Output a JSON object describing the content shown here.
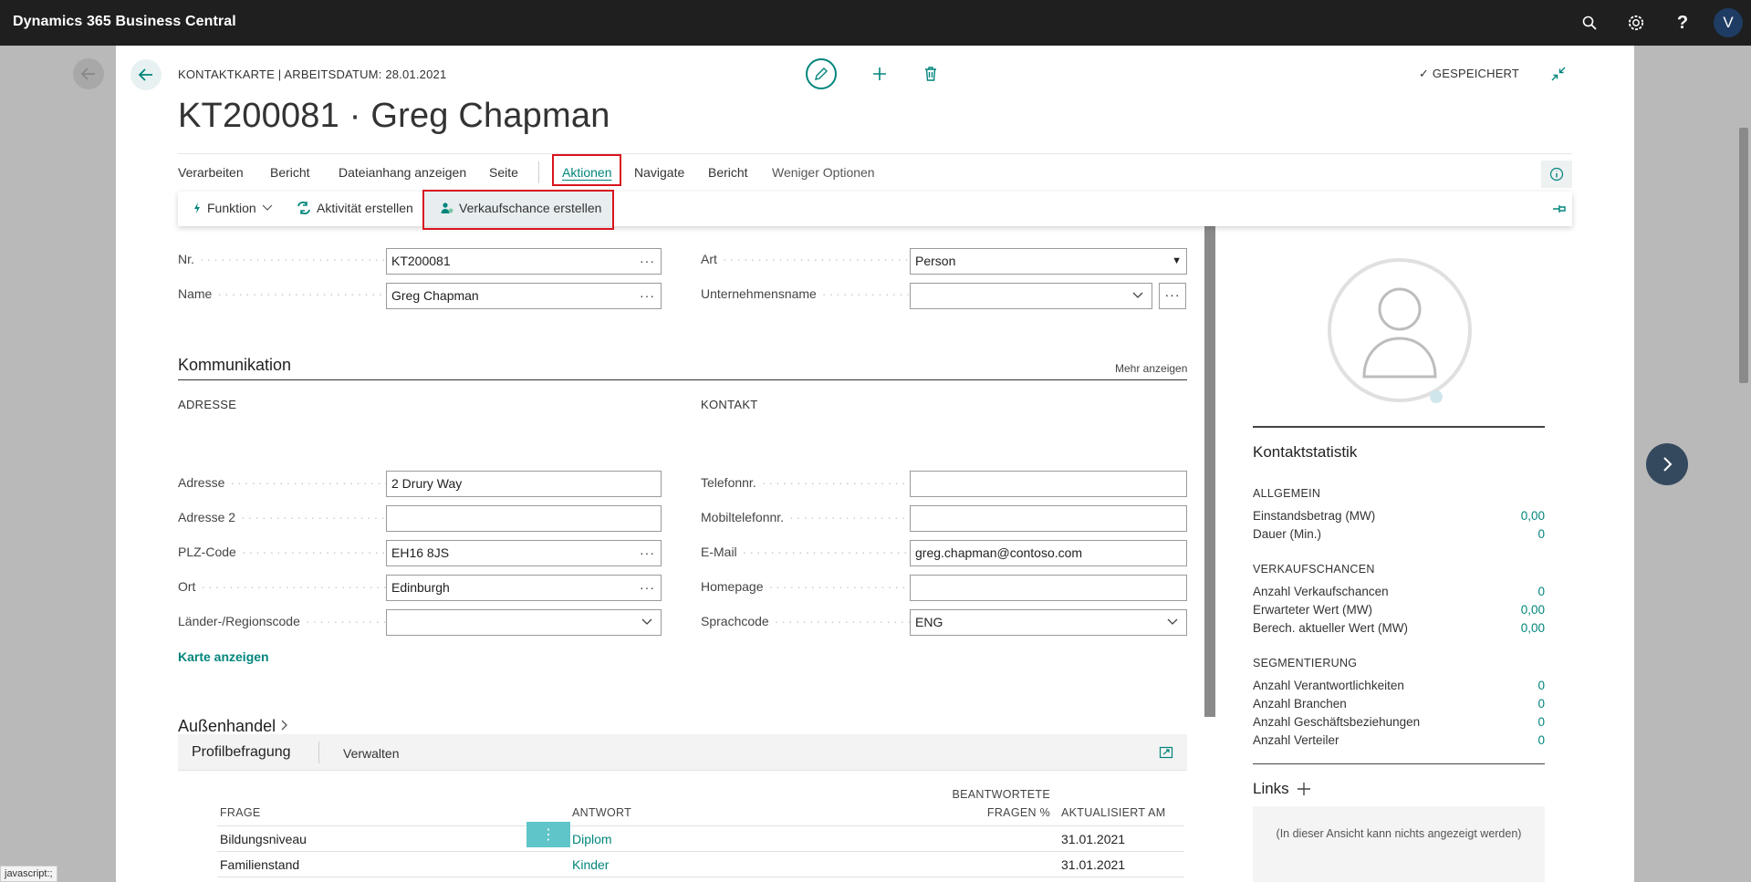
{
  "app": {
    "title": "Dynamics 365 Business Central",
    "user_initial": "V"
  },
  "header": {
    "breadcrumb": "KONTAKTKARTE | ARBEITSDATUM: 28.01.2021",
    "saved_label": "GESPEICHERT",
    "page_title": "KT200081 · Greg Chapman"
  },
  "actionbar": {
    "items": [
      "Verarbeiten",
      "Bericht",
      "Dateianhang anzeigen",
      "Seite",
      "Aktionen",
      "Navigate",
      "Bericht",
      "Weniger Optionen"
    ]
  },
  "submenu": {
    "items": [
      "Funktion",
      "Aktivität erstellen",
      "Verkaufschance erstellen"
    ]
  },
  "general": {
    "nr_label": "Nr.",
    "nr_value": "KT200081",
    "name_label": "Name",
    "name_value": "Greg Chapman",
    "art_label": "Art",
    "art_value": "Person",
    "company_label": "Unternehmensname",
    "company_value": ""
  },
  "communication": {
    "title": "Kommunikation",
    "more_link": "Mehr anzeigen",
    "address_head": "ADRESSE",
    "contact_head": "KONTAKT",
    "address_fields": [
      {
        "label": "Adresse",
        "value": "2 Drury Way"
      },
      {
        "label": "Adresse 2",
        "value": ""
      },
      {
        "label": "PLZ-Code",
        "value": "EH16 8JS"
      },
      {
        "label": "Ort",
        "value": "Edinburgh"
      },
      {
        "label": "Länder-/Regionscode",
        "value": ""
      }
    ],
    "contact_fields": [
      {
        "label": "Telefonnr.",
        "value": ""
      },
      {
        "label": "Mobiltelefonnr.",
        "value": ""
      },
      {
        "label": "E-Mail",
        "value": "greg.chapman@contoso.com"
      },
      {
        "label": "Homepage",
        "value": ""
      },
      {
        "label": "Sprachcode",
        "value": "ENG"
      }
    ],
    "map_link": "Karte anzeigen"
  },
  "foreign_trade": {
    "title": "Außenhandel"
  },
  "profile": {
    "title": "Profilbefragung",
    "manage": "Verwalten",
    "columns": {
      "frage": "FRAGE",
      "antwort": "ANTWORT",
      "beantwortete_1": "BEANTWORTETE",
      "beantwortete_2": "FRAGEN %",
      "aktualisiert": "AKTUALISIERT AM"
    },
    "rows": [
      {
        "frage": "Bildungsniveau",
        "antwort": "Diplom",
        "aktualisiert": "31.01.2021"
      },
      {
        "frage": "Familienstand",
        "antwort": "Kinder",
        "aktualisiert": "31.01.2021"
      }
    ]
  },
  "factbox": {
    "title": "Kontaktstatistik",
    "general_head": "ALLGEMEIN",
    "general": [
      {
        "label": "Einstandsbetrag (MW)",
        "value": "0,00"
      },
      {
        "label": "Dauer (Min.)",
        "value": "0"
      }
    ],
    "sales_head": "VERKAUFSCHANCEN",
    "sales": [
      {
        "label": "Anzahl Verkaufschancen",
        "value": "0"
      },
      {
        "label": "Erwarteter Wert (MW)",
        "value": "0,00"
      },
      {
        "label": "Berech. aktueller Wert (MW)",
        "value": "0,00"
      }
    ],
    "seg_head": "SEGMENTIERUNG",
    "seg": [
      {
        "label": "Anzahl Verantwortlichkeiten",
        "value": "0"
      },
      {
        "label": "Anzahl Branchen",
        "value": "0"
      },
      {
        "label": "Anzahl Geschäftsbeziehungen",
        "value": "0"
      },
      {
        "label": "Anzahl Verteiler",
        "value": "0"
      }
    ],
    "links_title": "Links",
    "links_empty": "(In dieser Ansicht kann nichts angezeigt werden)"
  },
  "status_bar": "javascript:;",
  "colors": {
    "accent": "#00857c",
    "highlight": "#d9141e",
    "appbar": "#1f1f1f"
  },
  "icons": [
    "search-icon",
    "settings-icon",
    "help-icon",
    "back-arrow-icon",
    "edit-icon",
    "add-icon",
    "delete-icon",
    "check-icon",
    "collapse-icon",
    "info-icon",
    "pin-icon",
    "lightning-icon",
    "activity-icon",
    "opportunity-icon",
    "chevron-down-icon",
    "chevron-right-icon",
    "expand-icon",
    "user-silhouette-icon"
  ]
}
